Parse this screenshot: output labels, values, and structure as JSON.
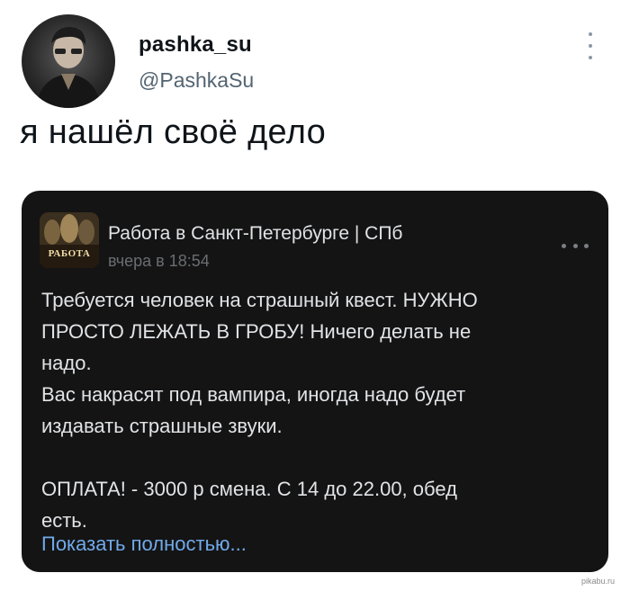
{
  "tweet": {
    "display_name": "pashka_su",
    "handle": "@PashkaSu",
    "text": "я нашёл своё дело"
  },
  "post": {
    "group_name": "Работа в Санкт-Петербурге | СПб",
    "avatar_text": "РАБОТА",
    "time": "вчера в 18:54",
    "body_lines": [
      "Требуется человек на страшный квест. НУЖНО",
      "ПРОСТО ЛЕЖАТЬ В ГРОБУ! Ничего делать не",
      "надо.",
      "Вас накрасят под вампира, иногда надо будет",
      "издавать страшные звуки.",
      "ОПЛАТА! - 3000 р смена. С 14 до 22.00, обед",
      "есть."
    ],
    "show_more": "Показать полностью..."
  },
  "watermark": "pikabu.ru",
  "colors": {
    "card_bg": "#141414",
    "link": "#71aaeb",
    "handle": "#536471"
  }
}
